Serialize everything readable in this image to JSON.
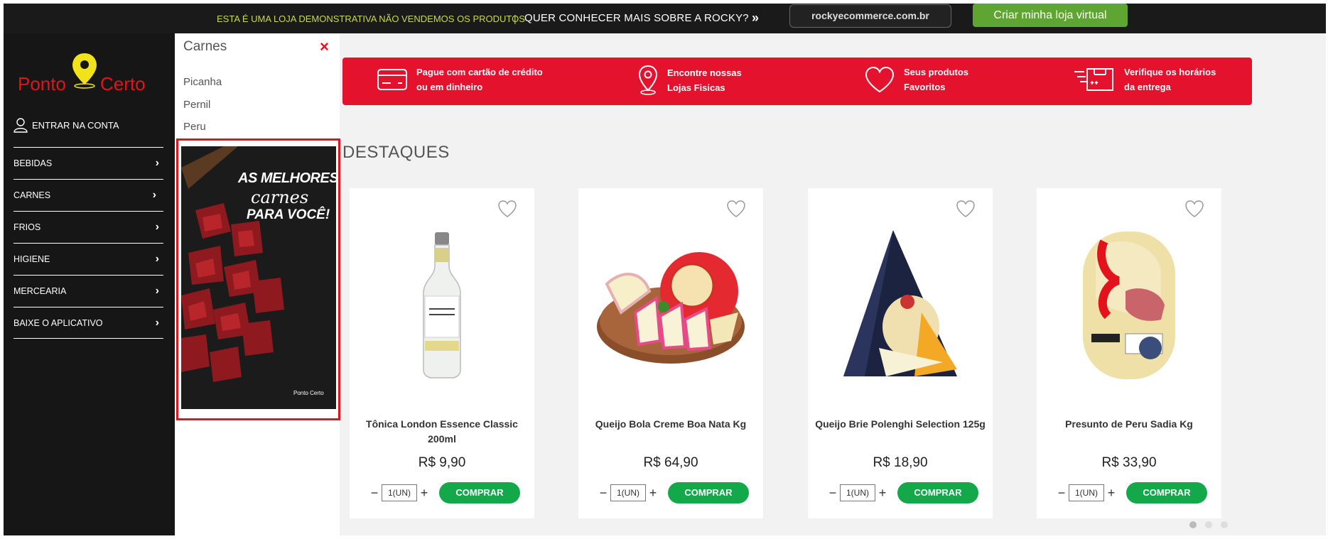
{
  "topbar": {
    "demo_text": "ESTA É UMA LOJA DEMONSTRATIVA NÃO VENDEMOS OS PRODUTOS",
    "separator": "|",
    "more_text": "QUER CONHECER MAIS SOBRE A ROCKY?",
    "chevron": "»",
    "domain_button": "rockyecommerce.com.br",
    "create_button": "Criar minha loja virtual"
  },
  "logo": {
    "left": "Ponto",
    "right": "Certo"
  },
  "sidebar": {
    "login_label": "ENTRAR NA CONTA",
    "items": [
      {
        "label": "BEBIDAS"
      },
      {
        "label": "CARNES"
      },
      {
        "label": "FRIOS"
      },
      {
        "label": "HIGIENE"
      },
      {
        "label": "MERCEARIA"
      },
      {
        "label": "BAIXE O APLICATIVO"
      }
    ]
  },
  "submenu": {
    "title": "Carnes",
    "close_icon": "×",
    "items": [
      "Picanha",
      "Pernil",
      "Peru"
    ],
    "banner": {
      "line1": "AS MELHORES",
      "line2": "carnes",
      "line3": "PARA VOCÊ!",
      "logo_text": "Ponto Certo"
    }
  },
  "info_strip": [
    {
      "icon": "credit-card-icon",
      "line1": "Pague com cartão de crédito",
      "line2": "ou em dinheiro"
    },
    {
      "icon": "map-pin-icon",
      "line1": "Encontre nossas",
      "line2": "Lojas Fisicas"
    },
    {
      "icon": "heart-icon",
      "line1": "Seus produtos",
      "line2": "Favoritos"
    },
    {
      "icon": "delivery-truck-icon",
      "line1": "Verifique os horários",
      "line2": "da entrega"
    }
  ],
  "section_title": "DESTAQUES",
  "products": [
    {
      "name": "Tônica London Essence Classic 200ml",
      "price": "R$ 9,90",
      "qty": "1(UN)",
      "buy": "COMPRAR"
    },
    {
      "name": "Queijo Bola Creme Boa Nata Kg",
      "price": "R$ 64,90",
      "qty": "1(UN)",
      "buy": "COMPRAR"
    },
    {
      "name": "Queijo Brie Polenghi Selection 125g",
      "price": "R$ 18,90",
      "qty": "1(UN)",
      "buy": "COMPRAR"
    },
    {
      "name": "Presunto de Peru Sadia Kg",
      "price": "R$ 33,90",
      "qty": "1(UN)",
      "buy": "COMPRAR"
    }
  ],
  "qty_minus": "−",
  "qty_plus": "+",
  "colors": {
    "brand_red": "#e4122d",
    "buy_green": "#13a94a",
    "create_green": "#5fa532",
    "sidebar_bg": "#161616"
  }
}
